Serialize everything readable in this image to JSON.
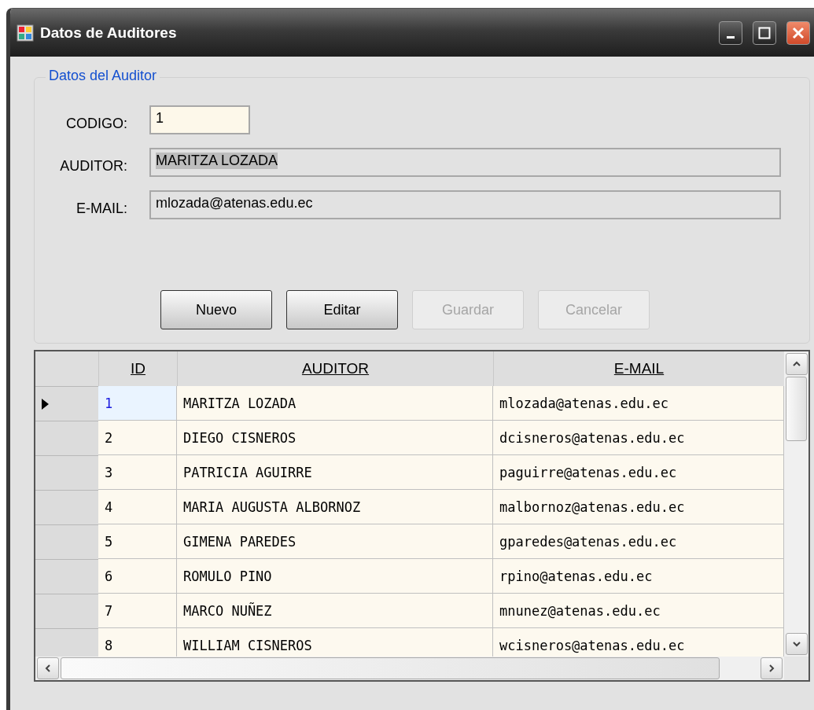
{
  "window": {
    "title": "Datos de Auditores"
  },
  "group": {
    "title": "Datos del Auditor",
    "fields": [
      {
        "label": "CODIGO:",
        "value": "1",
        "readonly": false,
        "text_selected": false
      },
      {
        "label": "AUDITOR:",
        "value": "MARITZA LOZADA",
        "readonly": true,
        "text_selected": true
      },
      {
        "label": "E-MAIL:",
        "value": "mlozada@atenas.edu.ec",
        "readonly": true,
        "text_selected": false
      }
    ],
    "buttons": [
      {
        "label": "Nuevo",
        "disabled": false
      },
      {
        "label": "Editar",
        "disabled": false
      },
      {
        "label": "Guardar",
        "disabled": true
      },
      {
        "label": "Cancelar",
        "disabled": true
      }
    ]
  },
  "table": {
    "columns": [
      "ID",
      "AUDITOR",
      "E-MAIL"
    ],
    "rows": [
      {
        "cells": [
          "1",
          "MARITZA LOZADA",
          "mlozada@atenas.edu.ec"
        ],
        "selected": true
      },
      {
        "cells": [
          "2",
          "DIEGO CISNEROS",
          "dcisneros@atenas.edu.ec"
        ],
        "selected": false
      },
      {
        "cells": [
          "3",
          "PATRICIA AGUIRRE",
          "paguirre@atenas.edu.ec"
        ],
        "selected": false
      },
      {
        "cells": [
          "4",
          "MARIA AUGUSTA ALBORNOZ",
          "malbornoz@atenas.edu.ec"
        ],
        "selected": false
      },
      {
        "cells": [
          "5",
          "GIMENA PAREDES",
          "gparedes@atenas.edu.ec"
        ],
        "selected": false
      },
      {
        "cells": [
          "6",
          "ROMULO PINO",
          "rpino@atenas.edu.ec"
        ],
        "selected": false
      },
      {
        "cells": [
          "7",
          "MARCO NUÑEZ",
          "mnunez@atenas.edu.ec"
        ],
        "selected": false
      },
      {
        "cells": [
          "8",
          "WILLIAM CISNEROS",
          "wcisneros@atenas.edu.ec"
        ],
        "selected": false
      }
    ]
  }
}
